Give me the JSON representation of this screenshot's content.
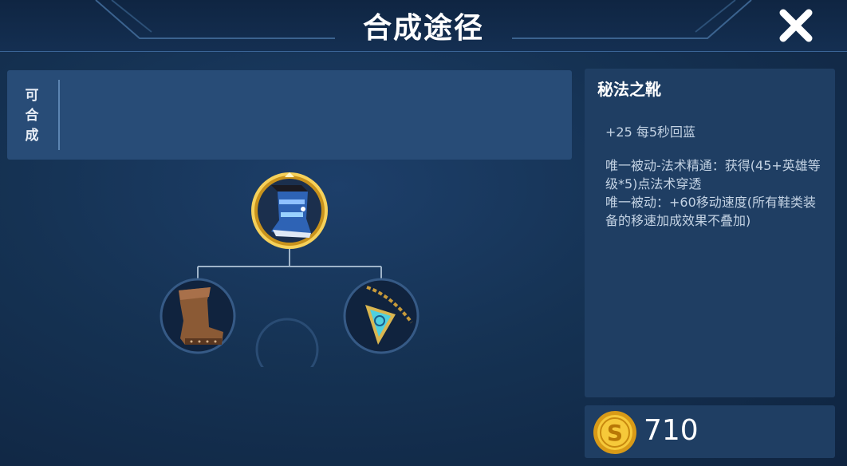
{
  "header": {
    "title": "合成途径",
    "close_icon": "close-icon"
  },
  "recipe": {
    "label_chars": [
      "可",
      "合",
      "成"
    ]
  },
  "tree": {
    "root": {
      "name": "秘法之靴",
      "icon": "mystic-boots-icon",
      "selected": true
    },
    "children": [
      {
        "icon": "leather-boots-icon"
      },
      {
        "icon": "amulet-pendant-icon"
      }
    ]
  },
  "item": {
    "name": "秘法之靴",
    "stat": "+25 每5秒回蓝",
    "passive": [
      "唯一被动-法术精通：获得(45+英雄等级*5)点法术穿透",
      "唯一被动：+60移动速度(所有鞋类装备的移速加成效果不叠加)"
    ]
  },
  "price": {
    "value": "710",
    "icon": "gold-coin-icon"
  },
  "colors": {
    "accent_gold": "#f3c13a",
    "panel": "#284c77",
    "background": "#153253"
  }
}
